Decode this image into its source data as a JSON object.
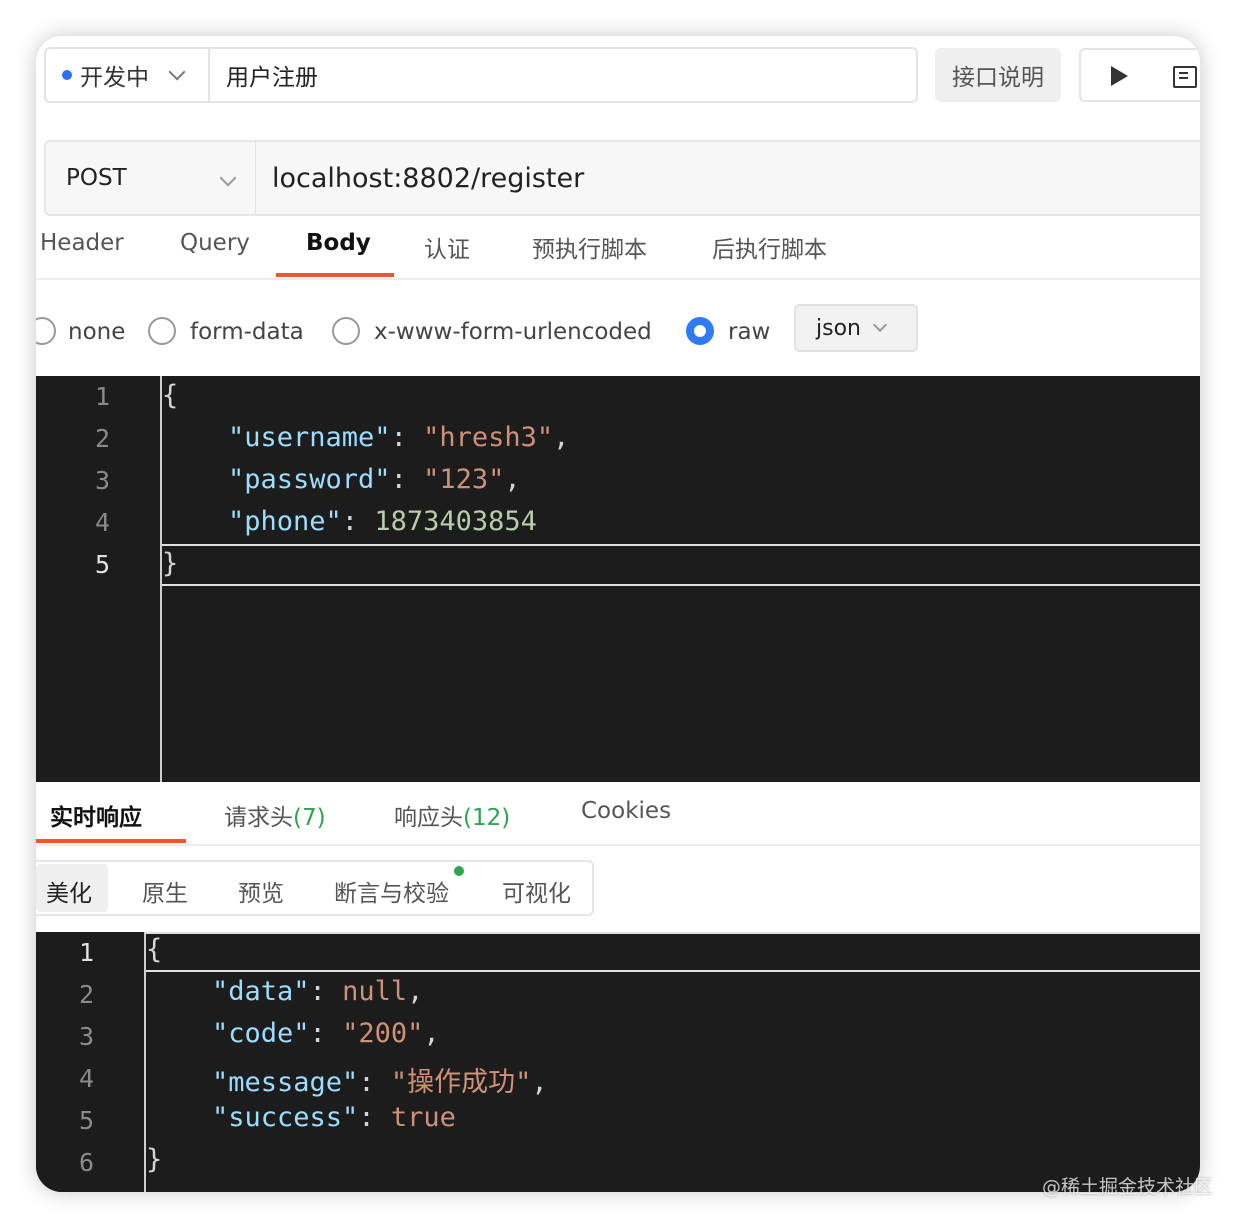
{
  "top": {
    "status": "开发中",
    "title": "用户注册",
    "doc_button": "接口说明"
  },
  "request": {
    "method": "POST",
    "url": "localhost:8802/register"
  },
  "tabs": [
    "Header",
    "Query",
    "Body",
    "认证",
    "预执行脚本",
    "后执行脚本"
  ],
  "body_types": {
    "none": "none",
    "form_data": "form-data",
    "urlencoded": "x-www-form-urlencoded",
    "raw": "raw",
    "format": "json"
  },
  "request_body": {
    "line_numbers": [
      "1",
      "2",
      "3",
      "4",
      "5"
    ],
    "open": "{",
    "close": "}",
    "lines": [
      {
        "key": "\"username\"",
        "value": "\"hresh3\"",
        "suffix": ","
      },
      {
        "key": "\"password\"",
        "value": "\"123\"",
        "suffix": ","
      },
      {
        "key": "\"phone\"",
        "value": "1873403854",
        "suffix": ""
      }
    ]
  },
  "response_tabs": {
    "live": "实时响应",
    "req_headers": "请求头",
    "req_headers_count": "(7)",
    "res_headers": "响应头",
    "res_headers_count": "(12)",
    "cookies": "Cookies"
  },
  "view_tabs": [
    "美化",
    "原生",
    "预览",
    "断言与校验",
    "可视化"
  ],
  "response_body": {
    "line_numbers": [
      "1",
      "2",
      "3",
      "4",
      "5",
      "6"
    ],
    "open": "{",
    "close": "}",
    "lines": [
      {
        "key": "\"data\"",
        "value": "null",
        "suffix": ","
      },
      {
        "key": "\"code\"",
        "value": "\"200\"",
        "suffix": ","
      },
      {
        "key": "\"message\"",
        "value": "\"操作成功\"",
        "suffix": ","
      },
      {
        "key": "\"success\"",
        "value": "true",
        "suffix": ""
      }
    ]
  },
  "watermark": "@稀土掘金技术社区",
  "colors": {
    "accent_tab": "#f0562b",
    "status_dot": "#2f6ff2",
    "radio_checked": "#2f7bf5",
    "count_green": "#2ea44f",
    "editor_bg": "#1c1c1c",
    "json_key": "#9cdcfe",
    "json_string": "#ce9178",
    "json_number": "#b5cea8"
  }
}
